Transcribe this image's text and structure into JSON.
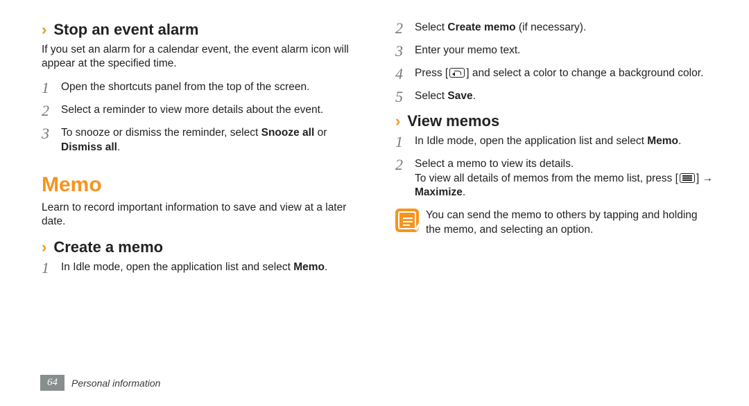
{
  "left": {
    "heading1": "Stop an event alarm",
    "intro1": "If you set an alarm for a calendar event, the event alarm icon will appear at the specified time.",
    "steps1": [
      "Open the shortcuts panel from the top of the screen.",
      "Select a reminder to view more details about the event.",
      "To snooze or dismiss the reminder, select <b>Snooze all</b> or <b>Dismiss all</b>."
    ],
    "section": "Memo",
    "intro2": "Learn to record important information to save and view at a later date.",
    "heading2": "Create a memo",
    "steps2": [
      "In Idle mode, open the application list and select <b>Memo</b>."
    ]
  },
  "right": {
    "steps_cont_start": 2,
    "steps_cont": [
      "Select <b>Create memo</b> (if necessary).",
      "Enter your memo text.",
      "Press [<back>] and select a color to change a background color.",
      "Select <b>Save</b>."
    ],
    "heading3": "View memos",
    "steps3": [
      "In Idle mode, open the application list and select <b>Memo</b>.",
      "Select a memo to view its details.<br>To view all details of memos from the memo list, press [<menu>] → <b>Maximize</b>."
    ],
    "note": "You can send the memo to others by tapping and holding the memo, and selecting an option."
  },
  "footer": {
    "page": "64",
    "chapter": "Personal information"
  }
}
